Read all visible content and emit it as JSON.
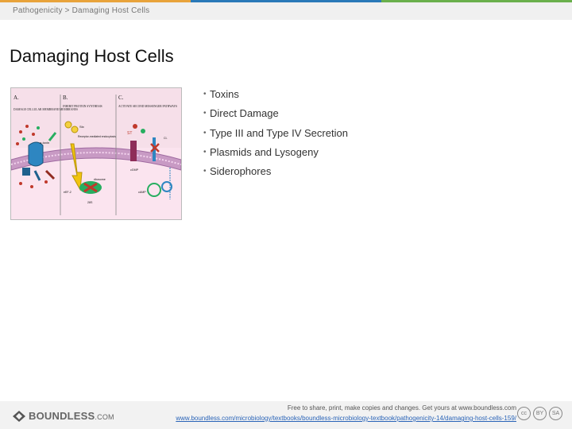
{
  "topbar": {
    "colors": [
      "#e8a33b",
      "#2a79b8",
      "#6ab04c"
    ]
  },
  "header": {
    "breadcrumb": "Pathogenicity > Damaging Host Cells"
  },
  "slide": {
    "title": "Damaging Host Cells",
    "bullets": [
      "Toxins",
      "Direct Damage",
      "Type III and Type IV Secretion",
      "Plasmids and Lysogeny",
      "Siderophores"
    ]
  },
  "figure": {
    "panels": [
      {
        "letter": "A.",
        "caption": "DAMAGE CELLULAR MEMBRANE/MEMBRANES"
      },
      {
        "letter": "B.",
        "caption": "INHIBIT PROTEIN SYNTHESIS"
      },
      {
        "letter": "C.",
        "caption": "ACTIVATE SECOND MESSENGER PATHWAYS"
      }
    ],
    "labels": {
      "a_toxin": "α-toxin",
      "stx": "Stx",
      "b_inside": "Receptor-mediated endocytosis",
      "st": "ST",
      "ribosome": "ribosome",
      "c_cgmp": "cGMP",
      "c_cl": "Cl-",
      "c_camp": "cAMP",
      "b_ef2": "eEF-2",
      "b_rna": "28S"
    }
  },
  "footer": {
    "brand": "BOUNDLESS",
    "brand_suffix": ".COM",
    "note": "Free to share, print, make copies and changes. Get yours at www.boundless.com",
    "url": "www.boundless.com/microbiology/textbooks/boundless-microbiology-textbook/pathogenicity-14/damaging-host-cells-159/",
    "cc_labels": [
      "cc",
      "BY",
      "SA"
    ]
  }
}
